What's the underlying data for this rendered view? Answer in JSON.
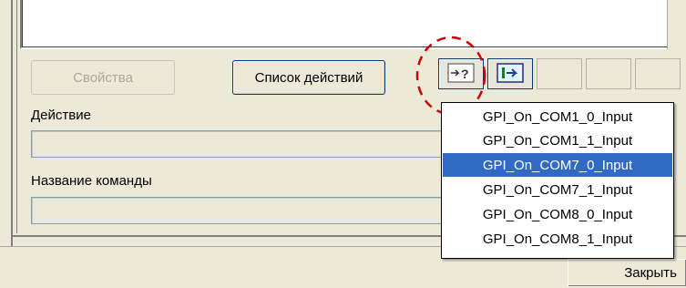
{
  "buttons": {
    "properties": "Свойства",
    "action_list": "Список действий",
    "close": "Закрыть"
  },
  "labels": {
    "action": "Действие",
    "command_name": "Название команды"
  },
  "toolbar": {
    "icon_insert_unknown": "insert-question-icon",
    "icon_insert_arrow": "insert-arrow-icon"
  },
  "dropdown": {
    "items": [
      {
        "label": "GPI_On_COM1_0_Input",
        "selected": false
      },
      {
        "label": "GPI_On_COM1_1_Input",
        "selected": false
      },
      {
        "label": "GPI_On_COM7_0_Input",
        "selected": true
      },
      {
        "label": "GPI_On_COM7_1_Input",
        "selected": false
      },
      {
        "label": "GPI_On_COM8_0_Input",
        "selected": false
      },
      {
        "label": "GPI_On_COM8_1_Input",
        "selected": false
      }
    ]
  },
  "colors": {
    "selection": "#316ac5",
    "highlight_circle": "#cc0000"
  }
}
